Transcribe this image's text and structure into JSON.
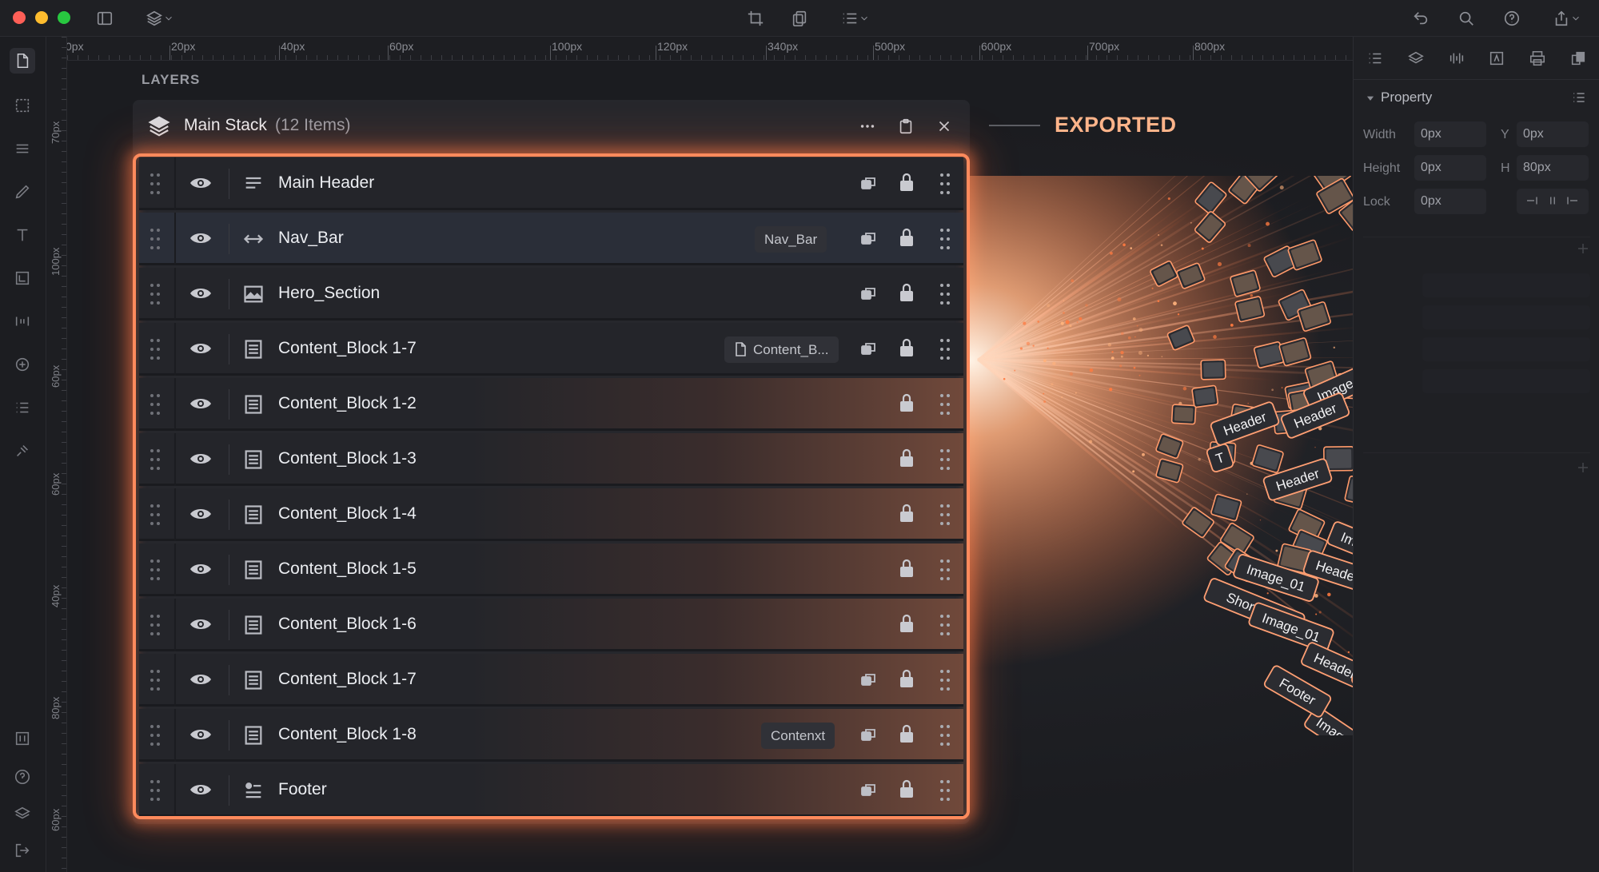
{
  "colors": {
    "accent": "#ff8a5c",
    "exported": "#ffb48a",
    "background": "#1b1c20",
    "panel": "#26272c"
  },
  "window": {
    "traffic_lights": [
      "#fe5f57",
      "#febc2e",
      "#28c840"
    ],
    "toolbar_icons": [
      "sidebar-toggle-icon",
      "layers-dropdown-icon",
      "crop-icon",
      "copy-icon",
      "list-dropdown-icon",
      "undo-icon",
      "search-icon",
      "help-icon",
      "share-icon"
    ]
  },
  "rulers": {
    "horizontal": [
      "0px",
      "20px",
      "40px",
      "60px",
      "100px",
      "120px",
      "340px",
      "500px",
      "600px",
      "700px",
      "800px"
    ],
    "vertical": [
      "70px",
      "100px",
      "60px",
      "60px",
      "40px",
      "80px",
      "60px"
    ]
  },
  "canvas": {
    "section_title": "LAYERS",
    "exported_label": "EXPORTED"
  },
  "panel": {
    "title": "Main Stack",
    "count": "(12 Items)",
    "rows": [
      {
        "name": "Main Header",
        "icon": "header-icon",
        "chip": "",
        "linked": true,
        "glow": false
      },
      {
        "name": "Nav_Bar",
        "icon": "nav-arrows-icon",
        "chip": "Nav_Bar",
        "linked": true,
        "glow": false
      },
      {
        "name": "Hero_Section",
        "icon": "image-icon",
        "chip": "",
        "linked": true,
        "glow": false
      },
      {
        "name": "Content_Block 1-7",
        "icon": "text-block-icon",
        "chip": "Content_B...",
        "linked": true,
        "glow": false
      },
      {
        "name": "Content_Block 1-2",
        "icon": "text-block-icon",
        "chip": "",
        "linked": false,
        "glow": true
      },
      {
        "name": "Content_Block 1-3",
        "icon": "text-block-icon",
        "chip": "",
        "linked": false,
        "glow": true
      },
      {
        "name": "Content_Block 1-4",
        "icon": "text-block-icon",
        "chip": "",
        "linked": false,
        "glow": true
      },
      {
        "name": "Content_Block 1-5",
        "icon": "text-block-icon",
        "chip": "",
        "linked": false,
        "glow": true
      },
      {
        "name": "Content_Block 1-6",
        "icon": "text-block-icon",
        "chip": "",
        "linked": false,
        "glow": true
      },
      {
        "name": "Content_Block 1-7",
        "icon": "text-block-icon",
        "chip": "",
        "linked": true,
        "glow": true
      },
      {
        "name": "Content_Block 1-8",
        "icon": "text-block-icon",
        "chip": "Contenxt",
        "linked": true,
        "glow": true
      },
      {
        "name": "Footer",
        "icon": "footer-icon",
        "chip": "",
        "linked": true,
        "glow": true
      }
    ]
  },
  "burst_labels": [
    "Header",
    "Header",
    "Image_01",
    "Header",
    "Image_01",
    "Header",
    "T",
    "Header",
    "Image_01",
    "Header",
    "Shortright",
    "Image_01",
    "Header",
    "Footer",
    "Image_01",
    "Image",
    "Footer"
  ],
  "property_panel": {
    "title": "Property",
    "width_label": "Width",
    "width_value": "0px",
    "y_label": "Y",
    "y_value": "0px",
    "height_label": "Height",
    "height_value": "0px",
    "h_label": "H",
    "h_value": "80px",
    "lock_label": "Lock",
    "lock_value": "0px"
  }
}
